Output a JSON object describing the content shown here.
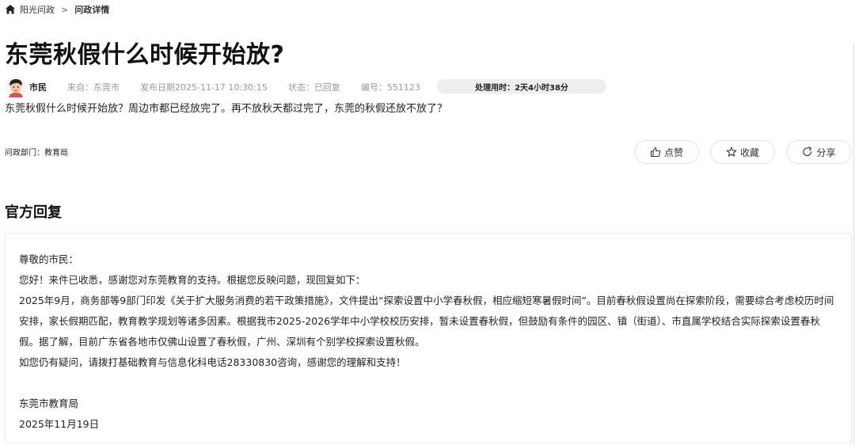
{
  "breadcrumb": {
    "home_icon": "home-icon",
    "root": "阳光问政",
    "separator": ">",
    "current": "问政详情"
  },
  "title": "东莞秋假什么时候开始放?",
  "meta": {
    "user": "市民",
    "source": "来自：东莞市",
    "date": "发布日期2025-11-17 10:30:15",
    "status": "状态：已回复",
    "number": "编号：551123",
    "processing_time": "处理用时：2天4小时38分"
  },
  "question": "东莞秋假什么时候开始放？周边市都已经放完了。再不放秋天都过完了，东莞的秋假还放不放了？",
  "department": "问政部门：教育局",
  "actions": {
    "like": "点赞",
    "favorite": "收藏",
    "share": "分享"
  },
  "reply": {
    "heading": "官方回复",
    "salutation": "尊敬的市民：",
    "line1": "您好！来件已收悉，感谢您对东莞教育的支持。根据您反映问题，现回复如下：",
    "para1": "2025年9月，商务部等9部门印发《关于扩大服务消费的若干政策措施》，文件提出“探索设置中小学春秋假，相应缩短寒暑假时间”。目前春秋假设置尚在探索阶段，需要综合考虑校历时间安排，家长假期匹配，教育教学规划等诸多因素。根据我市2025-2026学年中小学校校历安排，暂未设置春秋假，但鼓励有条件的园区、镇（街道）、市直属学校结合实际探索设置春秋假。据了解，目前广东省各地市仅佛山设置了春秋假，广州、深圳有个别学校探索设置秋假。",
    "para2": "如您仍有疑问，请拨打基础教育与信息化科电话28330830咨询，感谢您的理解和支持！",
    "signature": "东莞市教育局",
    "date": "2025年11月19日"
  },
  "colors": {
    "pill_bg": "#eeeeee",
    "border": "#e3e3e3",
    "text": "#222222",
    "muted": "#999999"
  }
}
